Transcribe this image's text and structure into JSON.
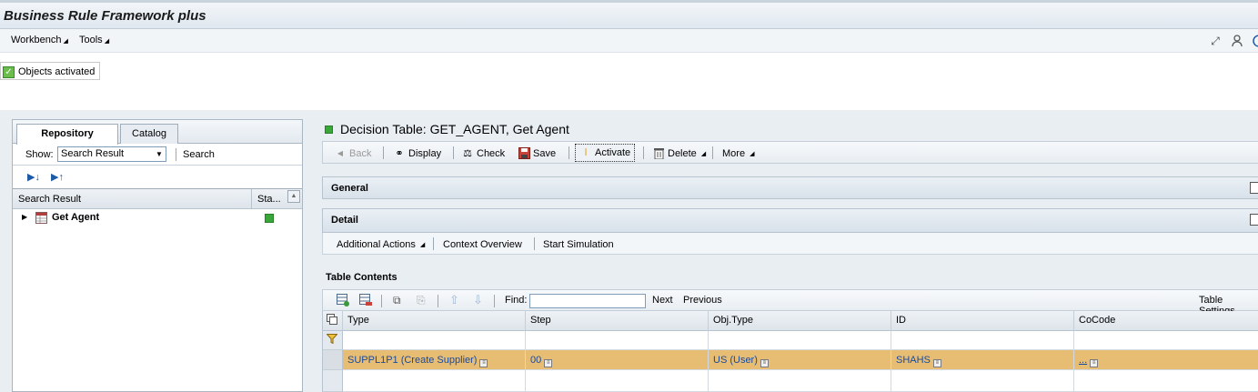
{
  "app": {
    "title": "Business Rule Framework plus"
  },
  "menu": {
    "workbench": "Workbench",
    "tools": "Tools"
  },
  "message": {
    "text": "Objects activated"
  },
  "left": {
    "tabs": [
      "Repository",
      "Catalog"
    ],
    "show_label": "Show:",
    "show_value": "Search Result",
    "search_label": "Search",
    "columns": [
      "Search Result",
      "Sta..."
    ],
    "tree": [
      {
        "label": "Get Agent",
        "status": "active"
      }
    ]
  },
  "object": {
    "title": "Decision Table: GET_AGENT, Get Agent",
    "toolbar": {
      "back": "Back",
      "display": "Display",
      "check": "Check",
      "save": "Save",
      "activate": "Activate",
      "delete": "Delete",
      "more": "More"
    }
  },
  "sections": {
    "general": "General",
    "detail": "Detail"
  },
  "detail_actions": [
    "Additional Actions",
    "Context Overview",
    "Start Simulation"
  ],
  "table": {
    "label": "Table Contents",
    "find_label": "Find:",
    "find_value": "",
    "next": "Next",
    "previous": "Previous",
    "settings": "Table Settings",
    "columns": [
      "Type",
      "Step",
      "Obj.Type",
      "ID",
      "CoCode"
    ],
    "rows": [
      {
        "type": "SUPPL1P1 (Create Supplier)",
        "step": "00",
        "objtype": "US (User)",
        "id": "SHAHS",
        "cocode": "..."
      }
    ]
  },
  "colors": {
    "selected_row": "#e7bd74",
    "status_green": "#39a839",
    "title_bg": "#dfe7ef"
  }
}
